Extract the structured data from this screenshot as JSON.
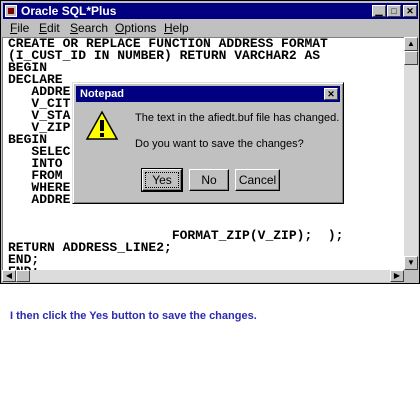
{
  "window": {
    "title": "Oracle SQL*Plus",
    "controls": [
      "minimize",
      "maximize",
      "close"
    ]
  },
  "menu": [
    {
      "label": "File",
      "accel": "F"
    },
    {
      "label": "Edit",
      "accel": "E"
    },
    {
      "label": "Search",
      "accel": "S"
    },
    {
      "label": "Options",
      "accel": "O"
    },
    {
      "label": "Help",
      "accel": "H"
    }
  ],
  "code_lines": [
    "CREATE OR REPLACE FUNCTION ADDRESS FORMAT",
    "(I_CUST_ID IN NUMBER) RETURN VARCHAR2 AS",
    "BEGIN",
    "DECLARE",
    "   ADDRE",
    "   V_CIT",
    "   V_STA",
    "   V_ZIP",
    "BEGIN",
    "   SELEC",
    "   INTO",
    "   FROM",
    "   WHERE",
    "   ADDRE",
    "",
    "",
    "                     FORMAT_ZIP(V_ZIP);  );",
    "RETURN ADDRESS_LINE2;",
    "END;",
    "END;",
    "/"
  ],
  "dialog": {
    "title": "Notepad",
    "message": "The text in the afiedt.buf file has changed.",
    "question": "Do you want to save the changes?",
    "icon": "warning-icon",
    "buttons": {
      "yes": "Yes",
      "no": "No",
      "cancel": "Cancel"
    }
  },
  "caption": "I then click the Yes button to save the changes.",
  "colors": {
    "titlebar": "#000080",
    "face": "#c0c0c0",
    "caption": "#2b2bb0"
  }
}
